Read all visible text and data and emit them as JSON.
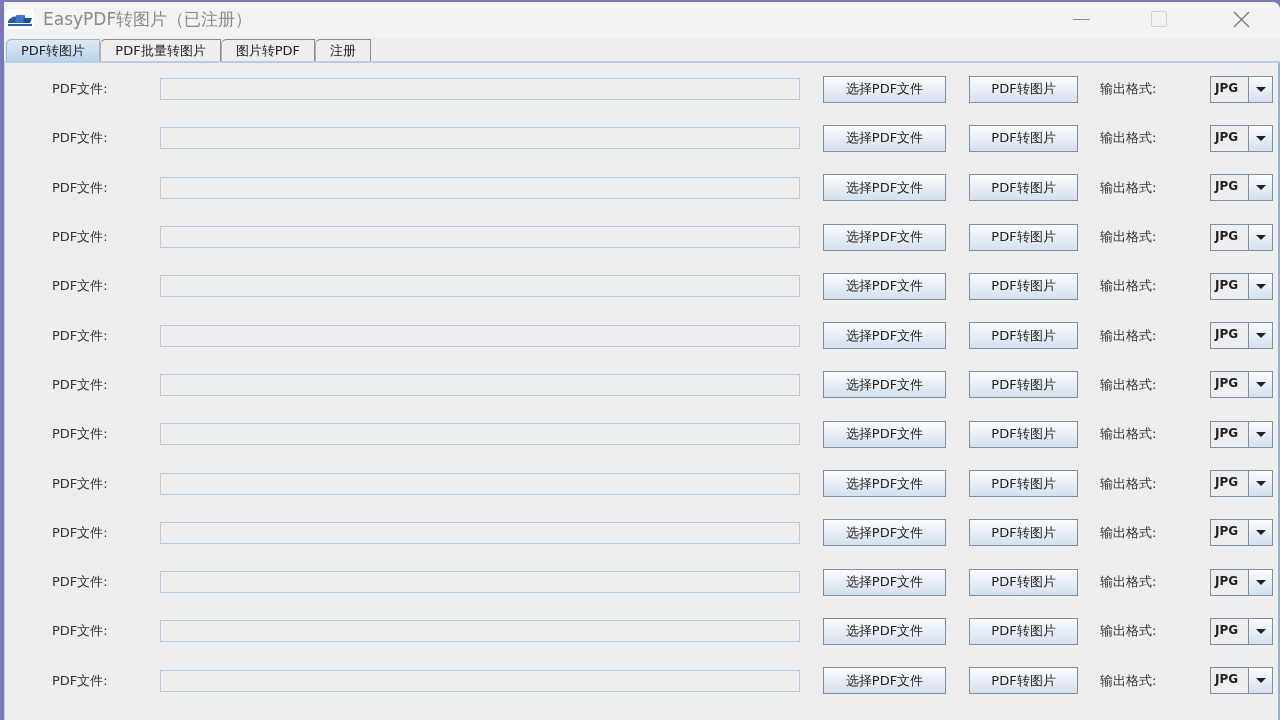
{
  "window": {
    "title": "EasyPDF转图片（已注册）"
  },
  "tabs": [
    {
      "label": "PDF转图片",
      "selected": true
    },
    {
      "label": "PDF批量转图片",
      "selected": false
    },
    {
      "label": "图片转PDF",
      "selected": false
    },
    {
      "label": "注册",
      "selected": false
    }
  ],
  "rows": [
    {
      "file_label": "PDF文件:",
      "choose_button": "选择PDF文件",
      "convert_button": "PDF转图片",
      "format_label": "输出格式:",
      "format": "JPG"
    },
    {
      "file_label": "PDF文件:",
      "choose_button": "选择PDF文件",
      "convert_button": "PDF转图片",
      "format_label": "输出格式:",
      "format": "JPG"
    },
    {
      "file_label": "PDF文件:",
      "choose_button": "选择PDF文件",
      "convert_button": "PDF转图片",
      "format_label": "输出格式:",
      "format": "JPG"
    },
    {
      "file_label": "PDF文件:",
      "choose_button": "选择PDF文件",
      "convert_button": "PDF转图片",
      "format_label": "输出格式:",
      "format": "JPG"
    },
    {
      "file_label": "PDF文件:",
      "choose_button": "选择PDF文件",
      "convert_button": "PDF转图片",
      "format_label": "输出格式:",
      "format": "JPG"
    },
    {
      "file_label": "PDF文件:",
      "choose_button": "选择PDF文件",
      "convert_button": "PDF转图片",
      "format_label": "输出格式:",
      "format": "JPG"
    },
    {
      "file_label": "PDF文件:",
      "choose_button": "选择PDF文件",
      "convert_button": "PDF转图片",
      "format_label": "输出格式:",
      "format": "JPG"
    },
    {
      "file_label": "PDF文件:",
      "choose_button": "选择PDF文件",
      "convert_button": "PDF转图片",
      "format_label": "输出格式:",
      "format": "JPG"
    },
    {
      "file_label": "PDF文件:",
      "choose_button": "选择PDF文件",
      "convert_button": "PDF转图片",
      "format_label": "输出格式:",
      "format": "JPG"
    },
    {
      "file_label": "PDF文件:",
      "choose_button": "选择PDF文件",
      "convert_button": "PDF转图片",
      "format_label": "输出格式:",
      "format": "JPG"
    },
    {
      "file_label": "PDF文件:",
      "choose_button": "选择PDF文件",
      "convert_button": "PDF转图片",
      "format_label": "输出格式:",
      "format": "JPG"
    },
    {
      "file_label": "PDF文件:",
      "choose_button": "选择PDF文件",
      "convert_button": "PDF转图片",
      "format_label": "输出格式:",
      "format": "JPG"
    },
    {
      "file_label": "PDF文件:",
      "choose_button": "选择PDF文件",
      "convert_button": "PDF转图片",
      "format_label": "输出格式:",
      "format": "JPG"
    }
  ]
}
